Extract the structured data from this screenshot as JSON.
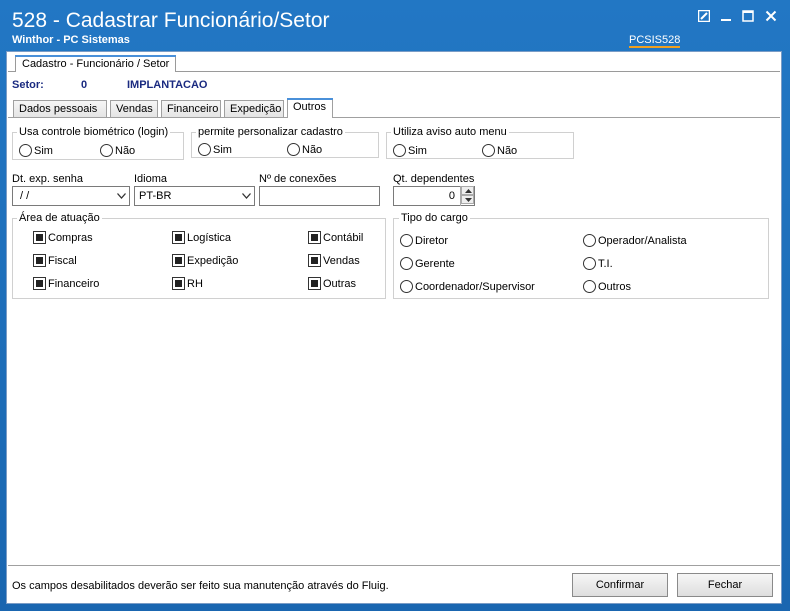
{
  "window": {
    "title": "528 - Cadastrar Funcionário/Setor",
    "subtitle": "Winthor - PC Sistemas",
    "code": "PCSIS528"
  },
  "outer_tab": "Cadastro - Funcionário / Setor",
  "setor": {
    "label": "Setor:",
    "code": "0",
    "name": "IMPLANTACAO"
  },
  "tabs": [
    "Dados pessoais",
    "Vendas",
    "Financeiro",
    "Expedição",
    "Outros"
  ],
  "active_tab": "Outros",
  "biometrico": {
    "title": "Usa controle biométrico (login)",
    "sim": "Sim",
    "nao": "Não"
  },
  "personalizar": {
    "title": "permite personalizar cadastro",
    "sim": "Sim",
    "nao": "Não"
  },
  "aviso_menu": {
    "title": "Utiliza aviso auto menu",
    "sim": "Sim",
    "nao": "Não"
  },
  "fields": {
    "dt_exp_label": "Dt. exp. senha",
    "dt_exp_value": " / /",
    "idioma_label": "Idioma",
    "idioma_value": "PT-BR",
    "conexoes_label": "Nº de conexões",
    "conexoes_value": "",
    "dependentes_label": "Qt. dependentes",
    "dependentes_value": "0"
  },
  "area_atuacao": {
    "title": "Área de atuação",
    "items": [
      "Compras",
      "Logística",
      "Contábil",
      "Fiscal",
      "Expedição",
      "Vendas",
      "Financeiro",
      "RH",
      "Outras"
    ]
  },
  "tipo_cargo": {
    "title": "Tipo do cargo",
    "items": [
      "Diretor",
      "Operador/Analista",
      "Gerente",
      "T.I.",
      "Coordenador/Supervisor",
      "Outros"
    ]
  },
  "footer": {
    "message": "Os campos desabilitados deverão ser feito sua manutenção através do Fluig.",
    "confirm": "Confirmar",
    "close": "Fechar"
  },
  "colors": {
    "titlebar": "#1c6fb8",
    "accent": "#4a90d9",
    "setor_text": "#1a2a80"
  }
}
